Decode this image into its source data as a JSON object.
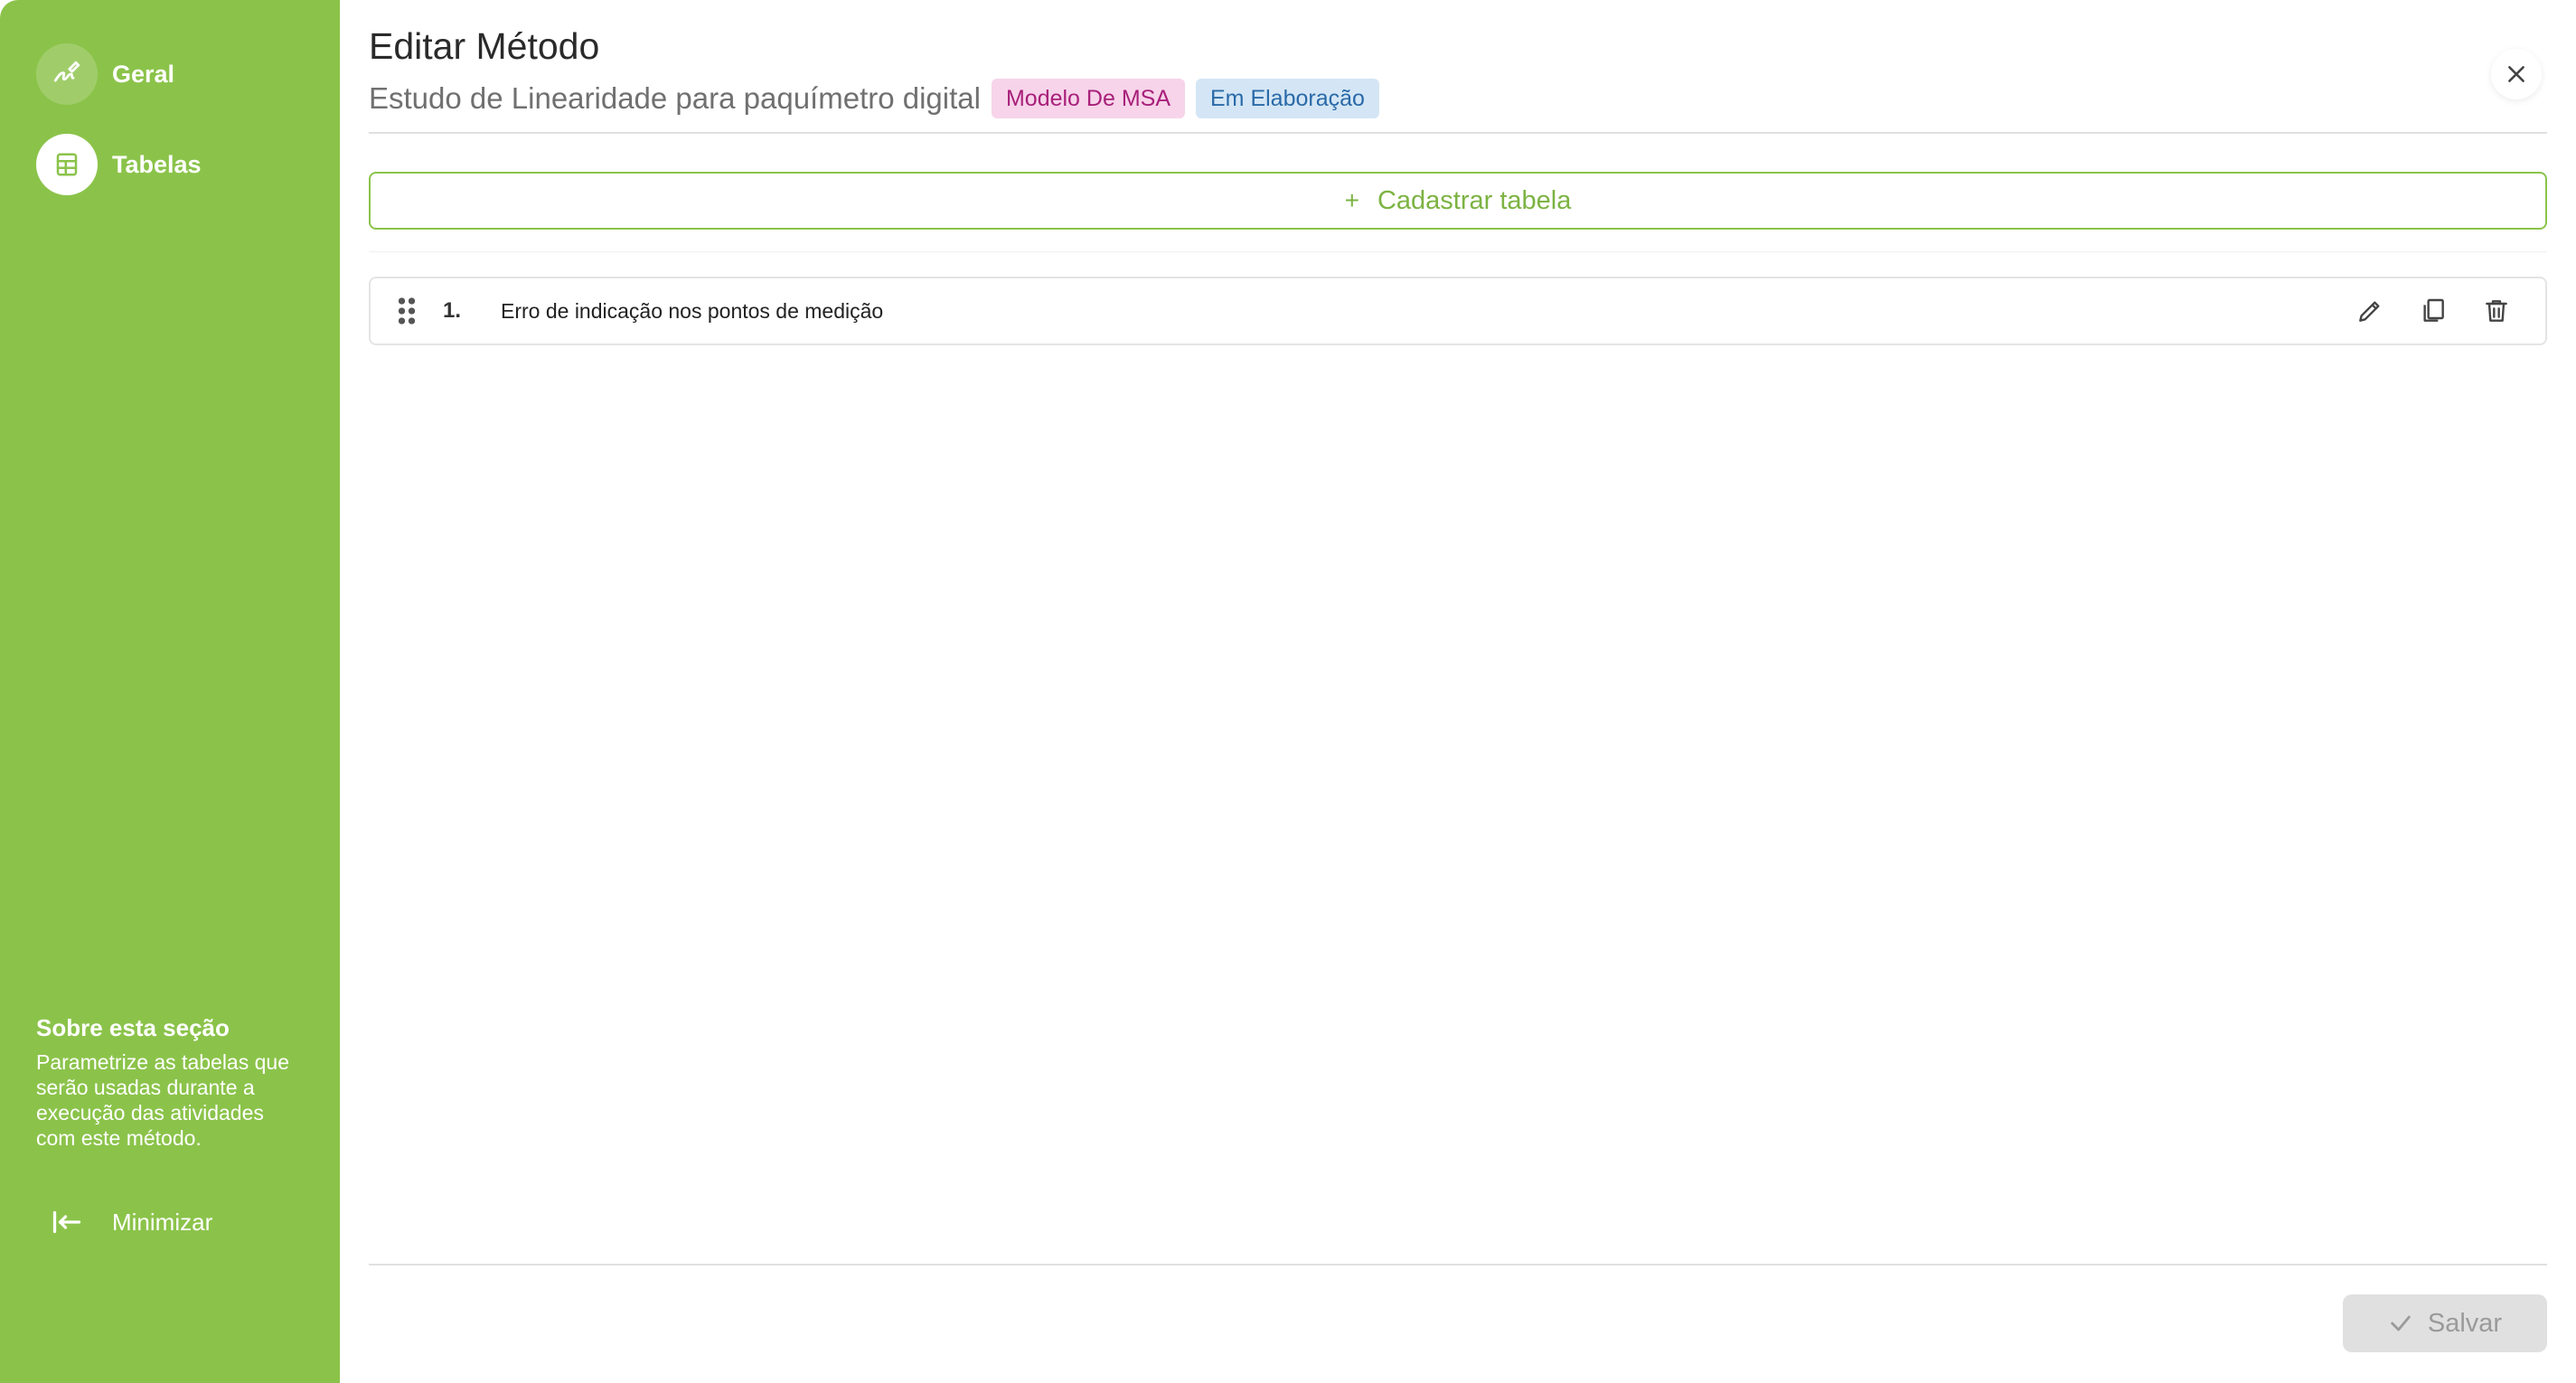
{
  "sidebar": {
    "items": [
      {
        "label": "Geral",
        "icon": "signature-icon",
        "active": false
      },
      {
        "label": "Tabelas",
        "icon": "table-icon",
        "active": true
      }
    ],
    "about": {
      "title": "Sobre esta seção",
      "text": "Parametrize as tabelas que serão usadas durante a execução das atividades com este método."
    },
    "minimize_label": "Minimizar"
  },
  "header": {
    "title": "Editar Método",
    "subtitle": "Estudo de Linearidade para paquímetro digital",
    "badges": [
      {
        "label": "Modelo De MSA",
        "color": "#a8207a",
        "bg": "#f7d4ea"
      },
      {
        "label": "Em Elaboração",
        "color": "#2a6aa8",
        "bg": "#d4e6f5"
      }
    ]
  },
  "main": {
    "add_button_label": "Cadastrar tabela",
    "tables": [
      {
        "index": "1.",
        "name": "Erro de indicação nos pontos de medição"
      }
    ]
  },
  "footer": {
    "save_label": "Salvar"
  },
  "colors": {
    "accent": "#8bc34a"
  }
}
